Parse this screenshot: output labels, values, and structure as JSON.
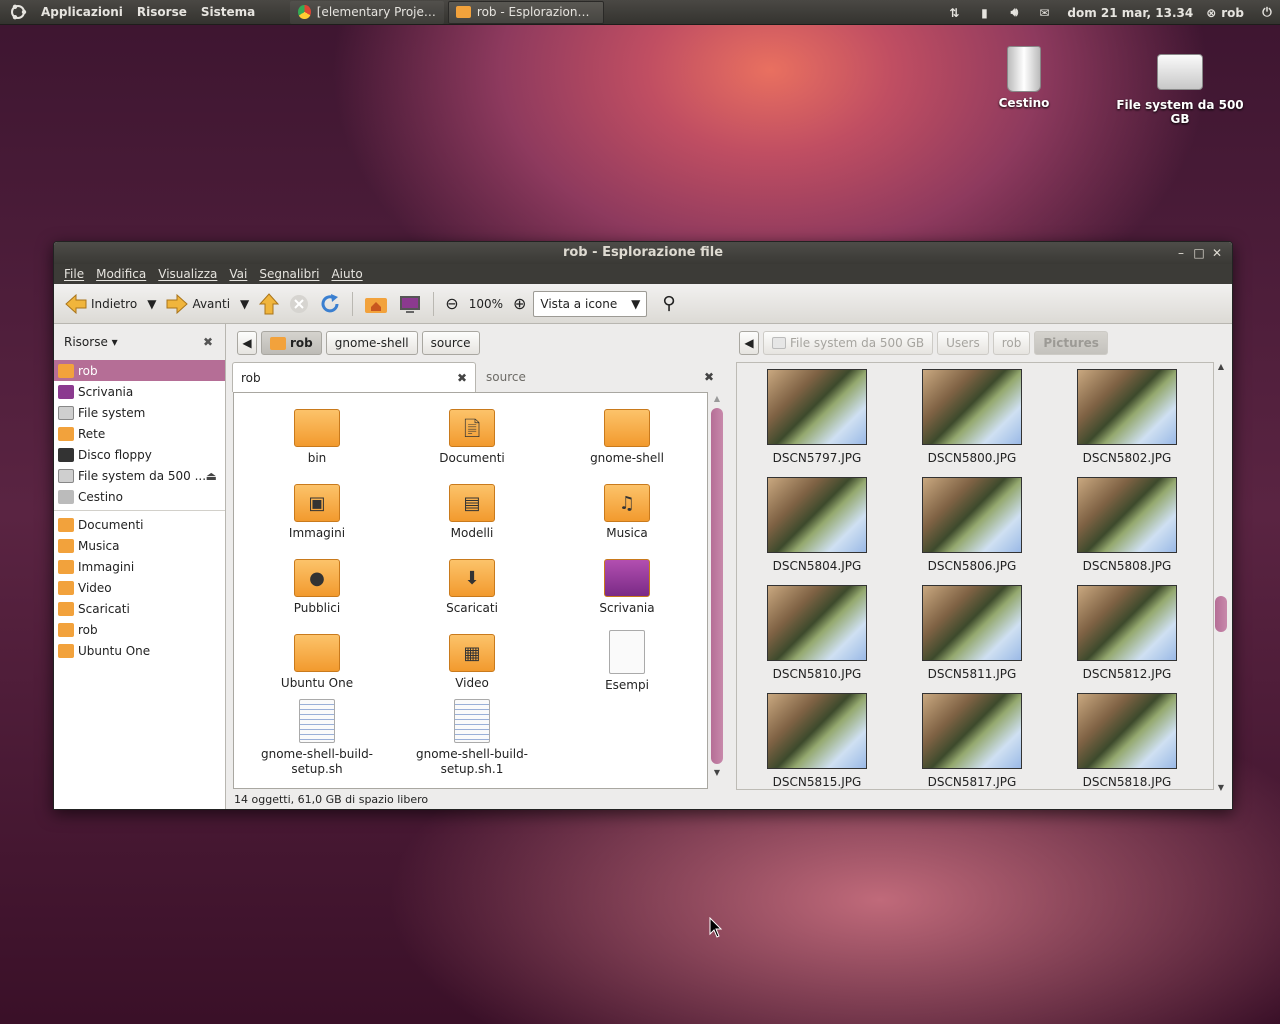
{
  "panel": {
    "menus": [
      "Applicazioni",
      "Risorse",
      "Sistema"
    ],
    "tasks": [
      "[elementary Project ...",
      "rob - Esplorazione file"
    ],
    "clock": "dom 21 mar, 13.34",
    "user": "rob"
  },
  "desktop": {
    "icons": [
      {
        "label": "Cestino",
        "icon": "trash-icon"
      },
      {
        "label": "File system da 500 GB",
        "icon": "harddisk-icon"
      }
    ]
  },
  "window": {
    "title": "rob - Esplorazione file",
    "menubar": [
      "File",
      "Modifica",
      "Visualizza",
      "Vai",
      "Segnalibri",
      "Aiuto"
    ],
    "toolbar": {
      "back": "Indietro",
      "forward": "Avanti",
      "zoom": "100%",
      "view": "Vista a icone"
    },
    "sidebar": {
      "header": "Risorse",
      "places": [
        "rob",
        "Scrivania",
        "File system",
        "Rete",
        "Disco floppy",
        "File system da 500 ...",
        "Cestino"
      ],
      "bookmarks": [
        "Documenti",
        "Musica",
        "Immagini",
        "Video",
        "Scaricati",
        "rob",
        "Ubuntu One"
      ],
      "selected": "rob"
    },
    "left_path": [
      "rob",
      "gnome-shell",
      "source"
    ],
    "tabs": [
      "rob",
      "source"
    ],
    "files": [
      "bin",
      "Documenti",
      "gnome-shell",
      "Immagini",
      "Modelli",
      "Musica",
      "Pubblici",
      "Scaricati",
      "Scrivania",
      "Ubuntu One",
      "Video",
      "Esempi",
      "gnome-shell-build-setup.sh",
      "gnome-shell-build-setup.sh.1"
    ],
    "right_path": [
      "File system da 500 GB",
      "Users",
      "rob",
      "Pictures"
    ],
    "photos": [
      "DSCN5797.JPG",
      "DSCN5800.JPG",
      "DSCN5802.JPG",
      "DSCN5804.JPG",
      "DSCN5806.JPG",
      "DSCN5808.JPG",
      "DSCN5810.JPG",
      "DSCN5811.JPG",
      "DSCN5812.JPG",
      "DSCN5815.JPG",
      "DSCN5817.JPG",
      "DSCN5818.JPG"
    ],
    "status": "14 oggetti, 61,0 GB di spazio libero"
  },
  "colors": {
    "selection": "#b56e96",
    "panel": "#3c3b37",
    "folder": "#f5a73a"
  }
}
